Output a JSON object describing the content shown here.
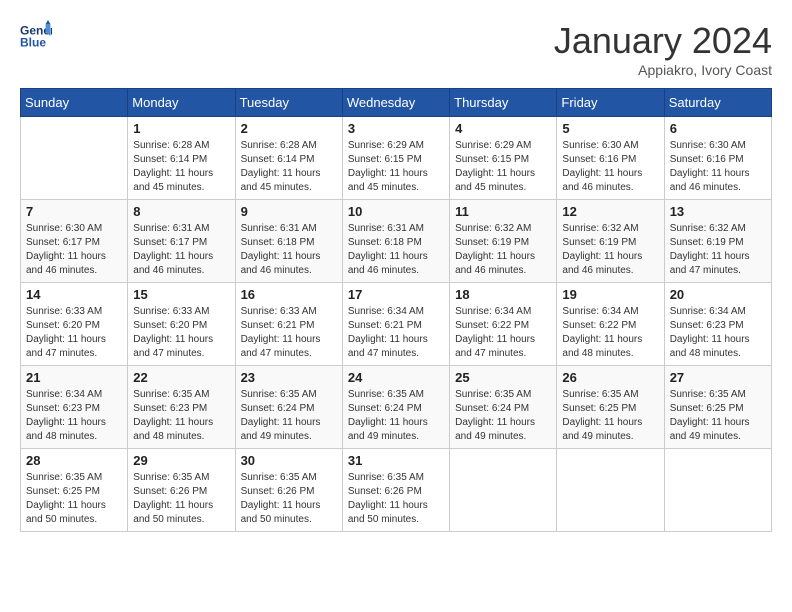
{
  "logo": {
    "line1": "General",
    "line2": "Blue"
  },
  "title": "January 2024",
  "subtitle": "Appiakro, Ivory Coast",
  "days_header": [
    "Sunday",
    "Monday",
    "Tuesday",
    "Wednesday",
    "Thursday",
    "Friday",
    "Saturday"
  ],
  "weeks": [
    [
      {
        "num": "",
        "sunrise": "",
        "sunset": "",
        "daylight": ""
      },
      {
        "num": "1",
        "sunrise": "Sunrise: 6:28 AM",
        "sunset": "Sunset: 6:14 PM",
        "daylight": "Daylight: 11 hours and 45 minutes."
      },
      {
        "num": "2",
        "sunrise": "Sunrise: 6:28 AM",
        "sunset": "Sunset: 6:14 PM",
        "daylight": "Daylight: 11 hours and 45 minutes."
      },
      {
        "num": "3",
        "sunrise": "Sunrise: 6:29 AM",
        "sunset": "Sunset: 6:15 PM",
        "daylight": "Daylight: 11 hours and 45 minutes."
      },
      {
        "num": "4",
        "sunrise": "Sunrise: 6:29 AM",
        "sunset": "Sunset: 6:15 PM",
        "daylight": "Daylight: 11 hours and 45 minutes."
      },
      {
        "num": "5",
        "sunrise": "Sunrise: 6:30 AM",
        "sunset": "Sunset: 6:16 PM",
        "daylight": "Daylight: 11 hours and 46 minutes."
      },
      {
        "num": "6",
        "sunrise": "Sunrise: 6:30 AM",
        "sunset": "Sunset: 6:16 PM",
        "daylight": "Daylight: 11 hours and 46 minutes."
      }
    ],
    [
      {
        "num": "7",
        "sunrise": "Sunrise: 6:30 AM",
        "sunset": "Sunset: 6:17 PM",
        "daylight": "Daylight: 11 hours and 46 minutes."
      },
      {
        "num": "8",
        "sunrise": "Sunrise: 6:31 AM",
        "sunset": "Sunset: 6:17 PM",
        "daylight": "Daylight: 11 hours and 46 minutes."
      },
      {
        "num": "9",
        "sunrise": "Sunrise: 6:31 AM",
        "sunset": "Sunset: 6:18 PM",
        "daylight": "Daylight: 11 hours and 46 minutes."
      },
      {
        "num": "10",
        "sunrise": "Sunrise: 6:31 AM",
        "sunset": "Sunset: 6:18 PM",
        "daylight": "Daylight: 11 hours and 46 minutes."
      },
      {
        "num": "11",
        "sunrise": "Sunrise: 6:32 AM",
        "sunset": "Sunset: 6:19 PM",
        "daylight": "Daylight: 11 hours and 46 minutes."
      },
      {
        "num": "12",
        "sunrise": "Sunrise: 6:32 AM",
        "sunset": "Sunset: 6:19 PM",
        "daylight": "Daylight: 11 hours and 46 minutes."
      },
      {
        "num": "13",
        "sunrise": "Sunrise: 6:32 AM",
        "sunset": "Sunset: 6:19 PM",
        "daylight": "Daylight: 11 hours and 47 minutes."
      }
    ],
    [
      {
        "num": "14",
        "sunrise": "Sunrise: 6:33 AM",
        "sunset": "Sunset: 6:20 PM",
        "daylight": "Daylight: 11 hours and 47 minutes."
      },
      {
        "num": "15",
        "sunrise": "Sunrise: 6:33 AM",
        "sunset": "Sunset: 6:20 PM",
        "daylight": "Daylight: 11 hours and 47 minutes."
      },
      {
        "num": "16",
        "sunrise": "Sunrise: 6:33 AM",
        "sunset": "Sunset: 6:21 PM",
        "daylight": "Daylight: 11 hours and 47 minutes."
      },
      {
        "num": "17",
        "sunrise": "Sunrise: 6:34 AM",
        "sunset": "Sunset: 6:21 PM",
        "daylight": "Daylight: 11 hours and 47 minutes."
      },
      {
        "num": "18",
        "sunrise": "Sunrise: 6:34 AM",
        "sunset": "Sunset: 6:22 PM",
        "daylight": "Daylight: 11 hours and 47 minutes."
      },
      {
        "num": "19",
        "sunrise": "Sunrise: 6:34 AM",
        "sunset": "Sunset: 6:22 PM",
        "daylight": "Daylight: 11 hours and 48 minutes."
      },
      {
        "num": "20",
        "sunrise": "Sunrise: 6:34 AM",
        "sunset": "Sunset: 6:23 PM",
        "daylight": "Daylight: 11 hours and 48 minutes."
      }
    ],
    [
      {
        "num": "21",
        "sunrise": "Sunrise: 6:34 AM",
        "sunset": "Sunset: 6:23 PM",
        "daylight": "Daylight: 11 hours and 48 minutes."
      },
      {
        "num": "22",
        "sunrise": "Sunrise: 6:35 AM",
        "sunset": "Sunset: 6:23 PM",
        "daylight": "Daylight: 11 hours and 48 minutes."
      },
      {
        "num": "23",
        "sunrise": "Sunrise: 6:35 AM",
        "sunset": "Sunset: 6:24 PM",
        "daylight": "Daylight: 11 hours and 49 minutes."
      },
      {
        "num": "24",
        "sunrise": "Sunrise: 6:35 AM",
        "sunset": "Sunset: 6:24 PM",
        "daylight": "Daylight: 11 hours and 49 minutes."
      },
      {
        "num": "25",
        "sunrise": "Sunrise: 6:35 AM",
        "sunset": "Sunset: 6:24 PM",
        "daylight": "Daylight: 11 hours and 49 minutes."
      },
      {
        "num": "26",
        "sunrise": "Sunrise: 6:35 AM",
        "sunset": "Sunset: 6:25 PM",
        "daylight": "Daylight: 11 hours and 49 minutes."
      },
      {
        "num": "27",
        "sunrise": "Sunrise: 6:35 AM",
        "sunset": "Sunset: 6:25 PM",
        "daylight": "Daylight: 11 hours and 49 minutes."
      }
    ],
    [
      {
        "num": "28",
        "sunrise": "Sunrise: 6:35 AM",
        "sunset": "Sunset: 6:25 PM",
        "daylight": "Daylight: 11 hours and 50 minutes."
      },
      {
        "num": "29",
        "sunrise": "Sunrise: 6:35 AM",
        "sunset": "Sunset: 6:26 PM",
        "daylight": "Daylight: 11 hours and 50 minutes."
      },
      {
        "num": "30",
        "sunrise": "Sunrise: 6:35 AM",
        "sunset": "Sunset: 6:26 PM",
        "daylight": "Daylight: 11 hours and 50 minutes."
      },
      {
        "num": "31",
        "sunrise": "Sunrise: 6:35 AM",
        "sunset": "Sunset: 6:26 PM",
        "daylight": "Daylight: 11 hours and 50 minutes."
      },
      {
        "num": "",
        "sunrise": "",
        "sunset": "",
        "daylight": ""
      },
      {
        "num": "",
        "sunrise": "",
        "sunset": "",
        "daylight": ""
      },
      {
        "num": "",
        "sunrise": "",
        "sunset": "",
        "daylight": ""
      }
    ]
  ]
}
